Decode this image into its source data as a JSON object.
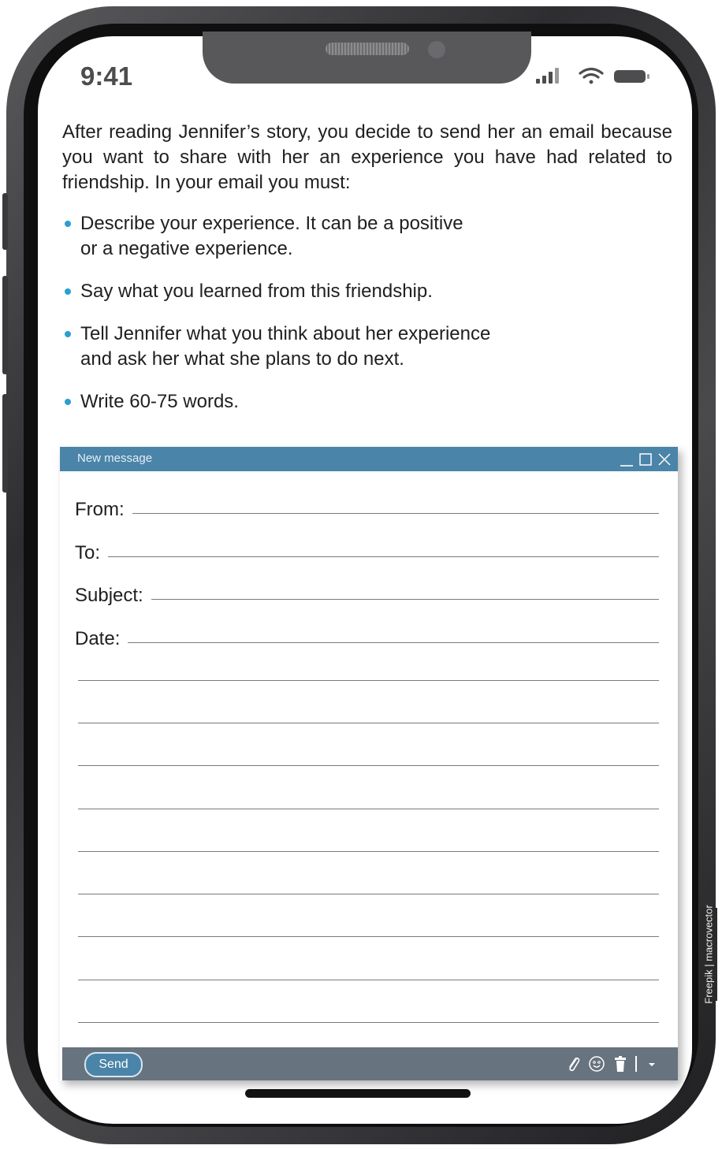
{
  "status_bar": {
    "time": "9:41",
    "icons": [
      "signal-icon",
      "wifi-icon",
      "battery-icon"
    ]
  },
  "instructions": {
    "intro": "After reading Jennifer’s story, you decide to send her an email because you want to share with her an experience you have had related to friendship. In your email you must:",
    "tasks": [
      {
        "line1": "Describe your experience. It can be a positive",
        "line2": "or a negative experience."
      },
      {
        "line1": "Say what you learned from this friendship.",
        "line2": ""
      },
      {
        "line1": "Tell Jennifer what you think about her experience",
        "line2": "and ask her what she plans to do next."
      },
      {
        "line1": "Write 60-75 words.",
        "line2": ""
      }
    ]
  },
  "email": {
    "window_title": "New message",
    "window_controls": [
      "minimize-icon",
      "maximize-icon",
      "close-icon"
    ],
    "fields": {
      "from_label": "From:",
      "to_label": "To:",
      "subject_label": "Subject:",
      "date_label": "Date:"
    },
    "send_label": "Send",
    "footer_tools": [
      "attach-icon",
      "emoji-icon",
      "trash-icon",
      "dropdown-arrow-icon"
    ]
  },
  "credit": "Freepik | macrovector",
  "colors": {
    "title_bar": "#4a84a9",
    "footer_bar": "#67737e",
    "bullet": "#2b9fd0"
  }
}
